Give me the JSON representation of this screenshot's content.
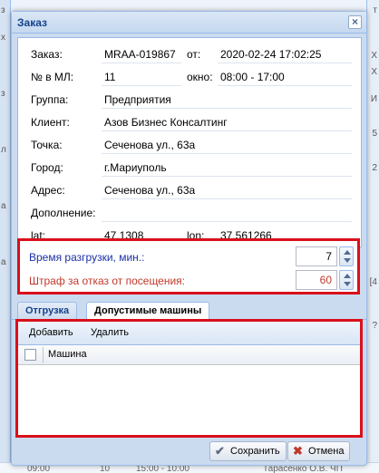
{
  "background": {
    "left_letters": [
      "з",
      "х",
      "з",
      "л",
      "а",
      "а"
    ],
    "right_letters": [
      "т",
      "X",
      "X",
      "И",
      "5",
      "2",
      "[4",
      "?"
    ],
    "bottom_items": [
      "09:00",
      "10",
      "15:00 - 10:00",
      "Тарасенко О.В. ЧП"
    ]
  },
  "window": {
    "title": "Заказ",
    "close_glyph": "×"
  },
  "form": {
    "order_label": "Заказ:",
    "order_value": "MRAA-019867",
    "from_label": "от:",
    "from_value": "2020-02-24 17:02:25",
    "ml_label": "№ в МЛ:",
    "ml_value": "11",
    "window_label": "окно:",
    "window_value": "08:00 - 17:00",
    "group_label": "Группа:",
    "group_value": "Предприятия",
    "client_label": "Клиент:",
    "client_value": "Азов Бизнес Консалтинг",
    "point_label": "Точка:",
    "point_value": "Сеченова ул., 63а",
    "city_label": "Город:",
    "city_value": "г.Мариуполь",
    "address_label": "Адрес:",
    "address_value": "Сеченова ул., 63а",
    "extra_label": "Дополнение:",
    "extra_value": "",
    "lat_label": "lat:",
    "lat_value": "47.1308",
    "lon_label": "lon:",
    "lon_value": "37.561266"
  },
  "spinners": {
    "unload_label": "Время разгрузки, мин.:",
    "unload_value": "7",
    "penalty_label": "Штраф за отказ от посещения:",
    "penalty_value": "60"
  },
  "tabs": {
    "shipment": "Отгрузка",
    "allowed_cars": "Допустимые машины"
  },
  "grid": {
    "add_label": "Добавить",
    "delete_label": "Удалить",
    "column_machine": "Машина"
  },
  "footer": {
    "save_label": "Сохранить",
    "cancel_label": "Отмена",
    "save_icon": "✔",
    "cancel_icon": "✖"
  },
  "colors": {
    "label_blue": "#1a2fa8",
    "label_red": "#c0392b",
    "highlight": "#d9101b",
    "title_blue": "#15428b"
  }
}
